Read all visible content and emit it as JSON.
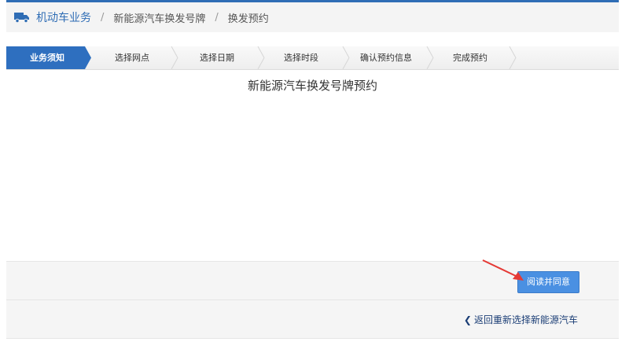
{
  "breadcrumb": {
    "root": "机动车业务",
    "level2": "新能源汽车换发号牌",
    "level3": "换发预约",
    "separator": "/"
  },
  "steps": [
    {
      "label": "业务须知",
      "active": true
    },
    {
      "label": "选择网点",
      "active": false
    },
    {
      "label": "选择日期",
      "active": false
    },
    {
      "label": "选择时段",
      "active": false
    },
    {
      "label": "确认预约信息",
      "active": false
    },
    {
      "label": "完成预约",
      "active": false
    }
  ],
  "main": {
    "title": "新能源汽车换发号牌预约"
  },
  "actions": {
    "agree_label": "阅读并同意",
    "back_label": "返回重新选择新能源汽车"
  },
  "colors": {
    "accent": "#2f6db5",
    "step_active": "#2e6fbf",
    "button": "#4a90e2",
    "arrow": "#e53935"
  }
}
